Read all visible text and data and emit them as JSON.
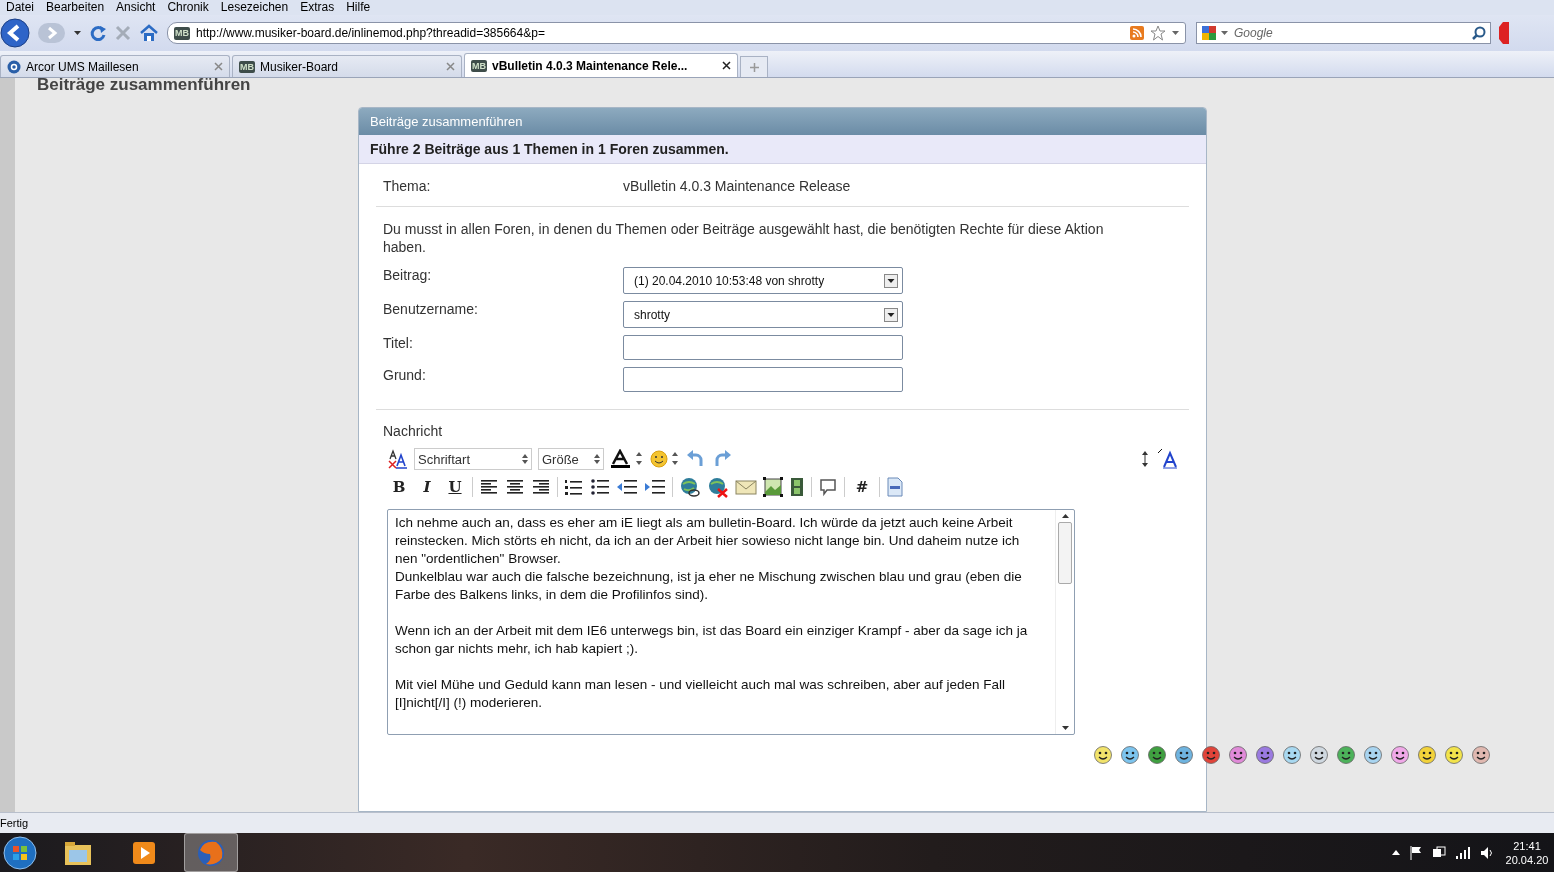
{
  "menu": [
    "Datei",
    "Bearbeiten",
    "Ansicht",
    "Chronik",
    "Lesezeichen",
    "Extras",
    "Hilfe"
  ],
  "address_bar": {
    "favicon": "MB",
    "url": "http://www.musiker-board.de/inlinemod.php?threadid=385664&p="
  },
  "search": {
    "placeholder": "Google"
  },
  "tabs": [
    {
      "label": "Arcor UMS Maillesen",
      "selected": false
    },
    {
      "label": "Musiker-Board",
      "favicon": "MB",
      "selected": false
    },
    {
      "label": "vBulletin 4.0.3 Maintenance Rele...",
      "favicon": "MB",
      "selected": true
    }
  ],
  "page_heading": "Beiträge zusammenführen",
  "form": {
    "title": "Beiträge zusammenführen",
    "subtitle": "Führe 2 Beiträge aus 1 Themen in 1 Foren zusammen.",
    "thread_label": "Thema:",
    "thread_value": "vBulletin 4.0.3 Maintenance Release",
    "notice": "Du musst in allen Foren, in denen du Themen oder Beiträge ausgewählt hast, die benötigten Rechte für diese Aktion haben.",
    "fields": [
      {
        "label": "Beitrag:",
        "kind": "select",
        "value": "(1) 20.04.2010 10:53:48 von shrotty"
      },
      {
        "label": "Benutzername:",
        "kind": "select",
        "value": "shrotty"
      },
      {
        "label": "Titel:",
        "kind": "text"
      },
      {
        "label": "Grund:",
        "kind": "text"
      }
    ],
    "message_label": "Nachricht",
    "editor": {
      "font_select": "Schriftart",
      "size_select": "Größe",
      "format_buttons": [
        "B",
        "I",
        "U"
      ],
      "tag_button": "#",
      "text": "Ich nehme auch an, dass es eher am iE liegt als am bulletin-Board. Ich würde da jetzt auch keine Arbeit reinstecken. Mich störts eh nicht, da ich an der Arbeit hier sowieso nicht lange bin. Und daheim nutze ich nen \"ordentlichen\" Browser.\nDunkelblau war auch die falsche bezeichnung, ist ja eher ne Mischung zwischen blau und grau (eben die Farbe des Balkens links, in dem die Profilinfos sind).\n\nWenn ich an der Arbeit mit dem IE6 unterwegs bin, ist das Board ein einziger Krampf - aber da sage ich ja schon gar nichts mehr, ich hab kapiert ;).\n\nMit viel Mühe und Geduld kann man lesen - und vielleicht auch mal was schreiben, aber auf jeden Fall [I]nicht[/I] (!) moderieren."
    }
  },
  "status_bar": "Fertig",
  "taskbar": {
    "time": "21:41",
    "date": "20.04.20"
  }
}
